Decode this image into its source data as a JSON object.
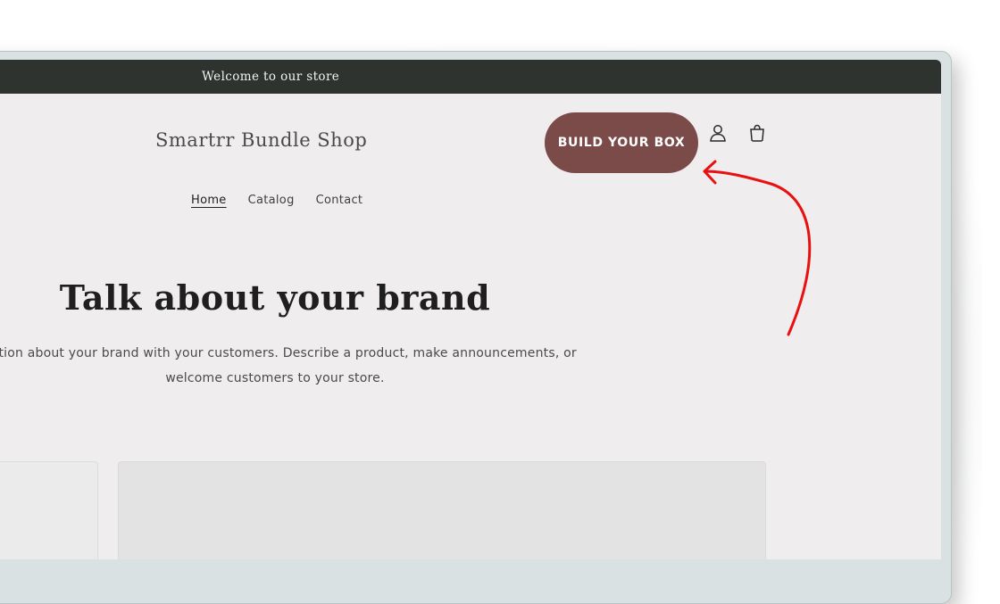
{
  "announcement": {
    "text": "Welcome to our store"
  },
  "header": {
    "shop_title": "Smartrr Bundle Shop",
    "cta_label": "BUILD YOUR BOX",
    "account_icon": "account-icon",
    "cart_icon": "cart-icon"
  },
  "nav": {
    "items": [
      {
        "label": "Home",
        "active": true
      },
      {
        "label": "Catalog",
        "active": false
      },
      {
        "label": "Contact",
        "active": false
      }
    ]
  },
  "hero": {
    "title": "Talk about your brand",
    "text_line1": "rmation about your brand with your customers. Describe a product, make announcements, or",
    "text_line2": "welcome customers to your store."
  },
  "colors": {
    "announcement_bg": "#2e332f",
    "page_bg": "#efeded",
    "cta_bg": "#7a4b49",
    "annotation_arrow": "#e81010"
  }
}
